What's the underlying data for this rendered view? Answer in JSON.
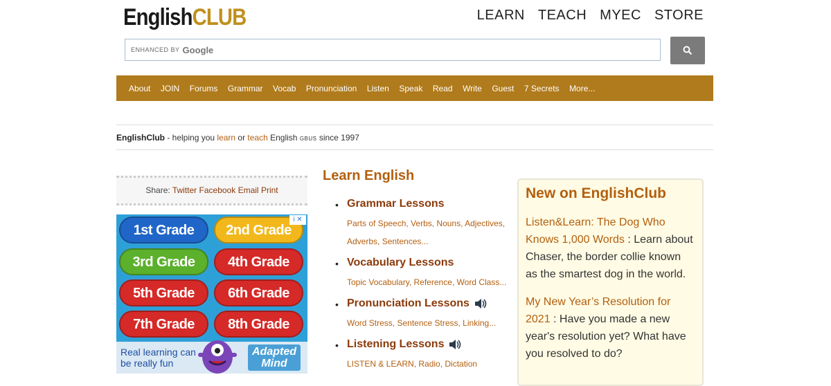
{
  "logo": {
    "english": "English",
    "club": "CLUB"
  },
  "topnav": [
    "LEARN",
    "TEACH",
    "MYEC",
    "STORE"
  ],
  "search": {
    "enhanced_by": "ENHANCED BY",
    "google": "Google",
    "placeholder": ""
  },
  "navbar": [
    "About",
    "JOIN",
    "Forums",
    "Grammar",
    "Vocab",
    "Pronunciation",
    "Listen",
    "Speak",
    "Read",
    "Write",
    "Guest",
    "7 Secrets",
    "More..."
  ],
  "tagline": {
    "brand": "EnglishClub",
    "t1": " - helping you ",
    "learn": "learn",
    "t2": " or ",
    "teach": "teach",
    "t3": " English ",
    "small": "GBUS",
    "t4": " since 1997"
  },
  "share": {
    "label": "Share: ",
    "links": [
      "Twitter",
      "Facebook",
      "Email",
      "Print"
    ]
  },
  "ad": {
    "grades": [
      "1st Grade",
      "2nd Grade",
      "3rd Grade",
      "4th Grade",
      "5th Grade",
      "6th Grade",
      "7th Grade",
      "8th Grade"
    ],
    "text_line1": "Real learning can",
    "text_line2": "be really fun",
    "logo_line1": "Adapted",
    "logo_line2": "Mind",
    "info": "i ✕"
  },
  "learn": {
    "heading": "Learn English",
    "lessons": [
      {
        "title": "Grammar Lessons",
        "desc": "Parts of Speech, Verbs, Nouns, Adjectives, Adverbs, Sentences..."
      },
      {
        "title": "Vocabulary Lessons",
        "desc": "Topic Vocabulary, Reference, Word Class..."
      },
      {
        "title": "Pronunciation Lessons",
        "desc": "Word Stress, Sentence Stress, Linking..."
      },
      {
        "title": "Listening Lessons",
        "desc": "LISTEN & LEARN, Radio, Dictation"
      }
    ]
  },
  "new_on": {
    "heading": "New on EnglishClub",
    "items": [
      {
        "link": "Listen&Learn: The Dog Who Knows 1,000 Words",
        "text": " : Learn about Chaser, the border collie known as the smartest dog in the world."
      },
      {
        "link": "My New Year’s Resolution for 2021",
        "text": " : Have you made a new year's resolution yet? What have you resolved to do?"
      }
    ]
  },
  "colors": {
    "accent": "#b07b1c",
    "link": "#b35f0f",
    "dark_link": "#8b3a0a",
    "box_bg": "#fffbe4"
  }
}
